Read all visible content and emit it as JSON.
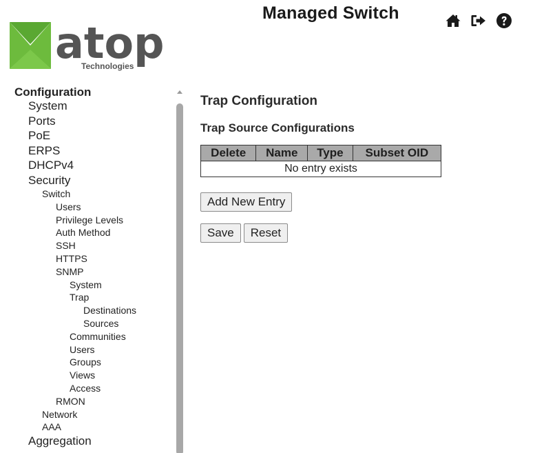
{
  "header": {
    "brand_name": "atop",
    "brand_tagline": "Technologies",
    "app_title": "Managed Switch",
    "icons": [
      "home-icon",
      "logout-icon",
      "help-icon"
    ]
  },
  "sidebar": {
    "root": "Configuration",
    "items": {
      "system": "System",
      "ports": "Ports",
      "poe": "PoE",
      "erps": "ERPS",
      "dhcpv4": "DHCPv4",
      "security": "Security",
      "switch": "Switch",
      "users": "Users",
      "privilege_levels": "Privilege Levels",
      "auth_method": "Auth Method",
      "ssh": "SSH",
      "https": "HTTPS",
      "snmp": "SNMP",
      "snmp_system": "System",
      "trap": "Trap",
      "destinations": "Destinations",
      "sources": "Sources",
      "communities": "Communities",
      "snmp_users": "Users",
      "groups": "Groups",
      "views": "Views",
      "access": "Access",
      "rmon": "RMON",
      "network": "Network",
      "aaa": "AAA",
      "aggregation": "Aggregation"
    }
  },
  "main": {
    "title": "Trap Configuration",
    "section_title": "Trap Source Configurations",
    "table": {
      "headers": [
        "Delete",
        "Name",
        "Type",
        "Subset OID"
      ],
      "empty_text": "No entry exists"
    },
    "buttons": {
      "add": "Add New Entry",
      "save": "Save",
      "reset": "Reset"
    }
  },
  "colors": {
    "logo_green": "#6dbb3d",
    "logo_gray": "#555555",
    "table_header_bg": "#a9a9a9",
    "scrollbar_thumb": "#a8a8a8"
  }
}
